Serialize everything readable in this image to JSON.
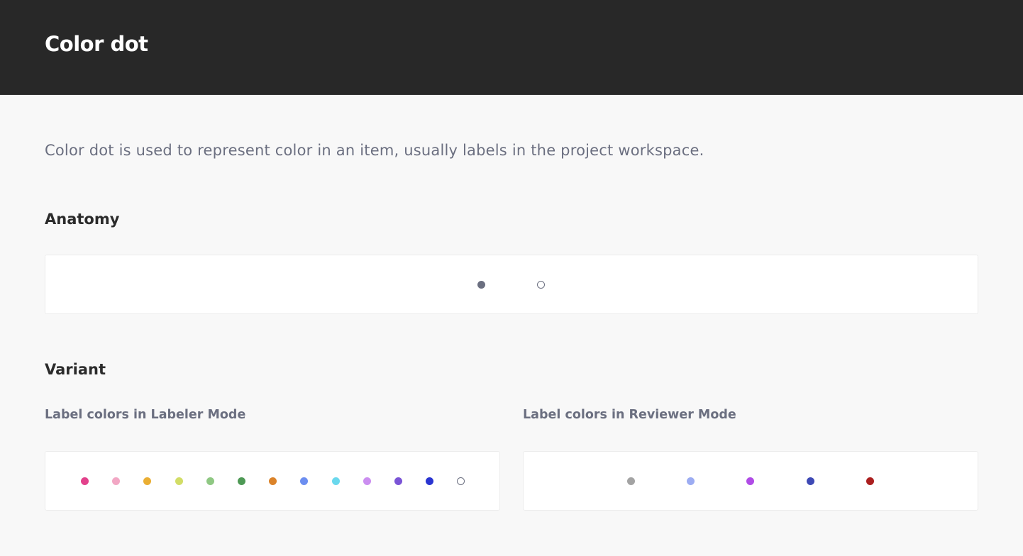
{
  "header": {
    "title": "Color dot"
  },
  "description": "Color dot is used to represent color in an item, usually labels in the project workspace.",
  "anatomy": {
    "heading": "Anatomy",
    "dots": [
      {
        "name": "filled-dot",
        "style": "filled",
        "color": "#6b6f80"
      },
      {
        "name": "outline-dot",
        "style": "outline",
        "color": "#6b6f80"
      }
    ]
  },
  "variant": {
    "heading": "Variant",
    "labeler": {
      "title": "Label colors in Labeler Mode",
      "colors": [
        "#e2418b",
        "#f2a7c4",
        "#eaae33",
        "#d2dd66",
        "#8fc883",
        "#4e9955",
        "#db8329",
        "#6c8ef0",
        "#6ad8ed",
        "#cb8ef0",
        "#7a54d6",
        "#2a35d1",
        "outline"
      ]
    },
    "reviewer": {
      "title": "Label colors in Reviewer Mode",
      "colors": [
        "#a3a3a3",
        "#9cacf2",
        "#b04be6",
        "#3e49b5",
        "#ab1f1f"
      ]
    }
  }
}
